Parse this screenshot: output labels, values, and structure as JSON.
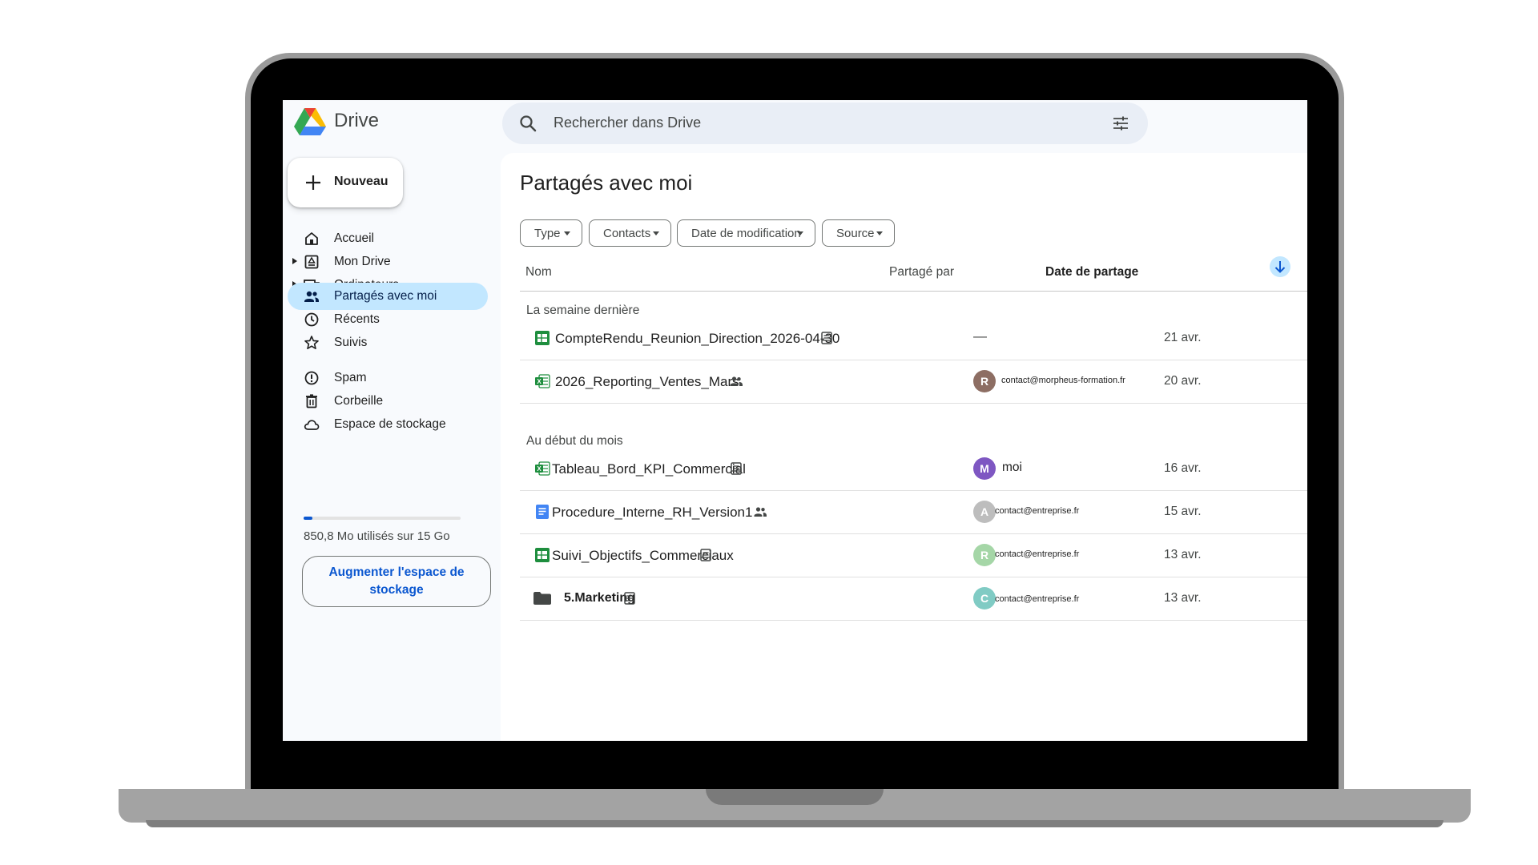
{
  "app": {
    "name": "Drive"
  },
  "search": {
    "placeholder": "Rechercher dans Drive"
  },
  "sidebar": {
    "new_button": "Nouveau",
    "items": [
      {
        "label": "Accueil",
        "icon": "home-icon"
      },
      {
        "label": "Mon Drive",
        "icon": "my-drive-icon"
      },
      {
        "label": "Ordinateurs",
        "icon": "computers-icon"
      },
      {
        "label": "Partagés avec moi",
        "icon": "shared-icon",
        "active": true
      },
      {
        "label": "Récents",
        "icon": "clock-icon"
      },
      {
        "label": "Suivis",
        "icon": "star-icon"
      },
      {
        "label": "Spam",
        "icon": "spam-icon"
      },
      {
        "label": "Corbeille",
        "icon": "trash-icon"
      },
      {
        "label": "Espace de stockage",
        "icon": "cloud-icon"
      }
    ],
    "storage": {
      "used_text": "850,8 Mo utilisés sur 15 Go",
      "used_fraction": 0.057
    },
    "upgrade_button": "Augmenter l'espace de stockage"
  },
  "main": {
    "title": "Partagés avec moi",
    "filters": [
      "Type",
      "Contacts",
      "Date de modification",
      "Source"
    ],
    "columns": {
      "name": "Nom",
      "shared_by": "Partagé par",
      "share_date": "Date de partage"
    },
    "sections": [
      {
        "label": "La semaine dernière",
        "files": [
          {
            "name": "CompteRendu_Reunion_Direction_2026-04-30",
            "type": "sheets",
            "badge": "offline",
            "shared_by": "—",
            "date": "21 avr."
          },
          {
            "name": "2026_Reporting_Ventes_Mars",
            "type": "excel",
            "badge": "shared",
            "avatar": "R",
            "shared_by": "contact@morpheus-formation.fr",
            "date": "20 avr."
          }
        ]
      },
      {
        "label": "Au début du mois",
        "files": [
          {
            "name": "Tableau_Bord_KPI_Commercial",
            "type": "excel",
            "badge": "offline",
            "avatar": "M",
            "shared_by": "moi",
            "date": "16 avr."
          },
          {
            "name": "Procedure_Interne_RH_Version1",
            "type": "docs",
            "badge": "shared",
            "avatar": "A",
            "shared_by": "contact@entreprise.fr",
            "date": "15 avr."
          },
          {
            "name": "Suivi_Objectifs_Commerciaux",
            "type": "sheets",
            "badge": "offline",
            "avatar": "R",
            "shared_by": "contact@entreprise.fr",
            "date": "13 avr."
          },
          {
            "name": "5.Marketing",
            "type": "folder",
            "badge": "offline",
            "avatar": "C",
            "shared_by": "contact@entreprise.fr",
            "date": "13 avr."
          }
        ]
      }
    ]
  },
  "colors": {
    "active_nav": "#c2e7ff",
    "accent": "#0b57d0",
    "sheets_green": "#1e8e3e",
    "docs_blue": "#4285f4",
    "avatar_r_brown": "#8d6e63",
    "avatar_m_purple": "#7e57c2",
    "avatar_a_grey": "#bdbdbd",
    "avatar_r_green": "#a5d6a7",
    "avatar_c_teal": "#80cbc4"
  }
}
